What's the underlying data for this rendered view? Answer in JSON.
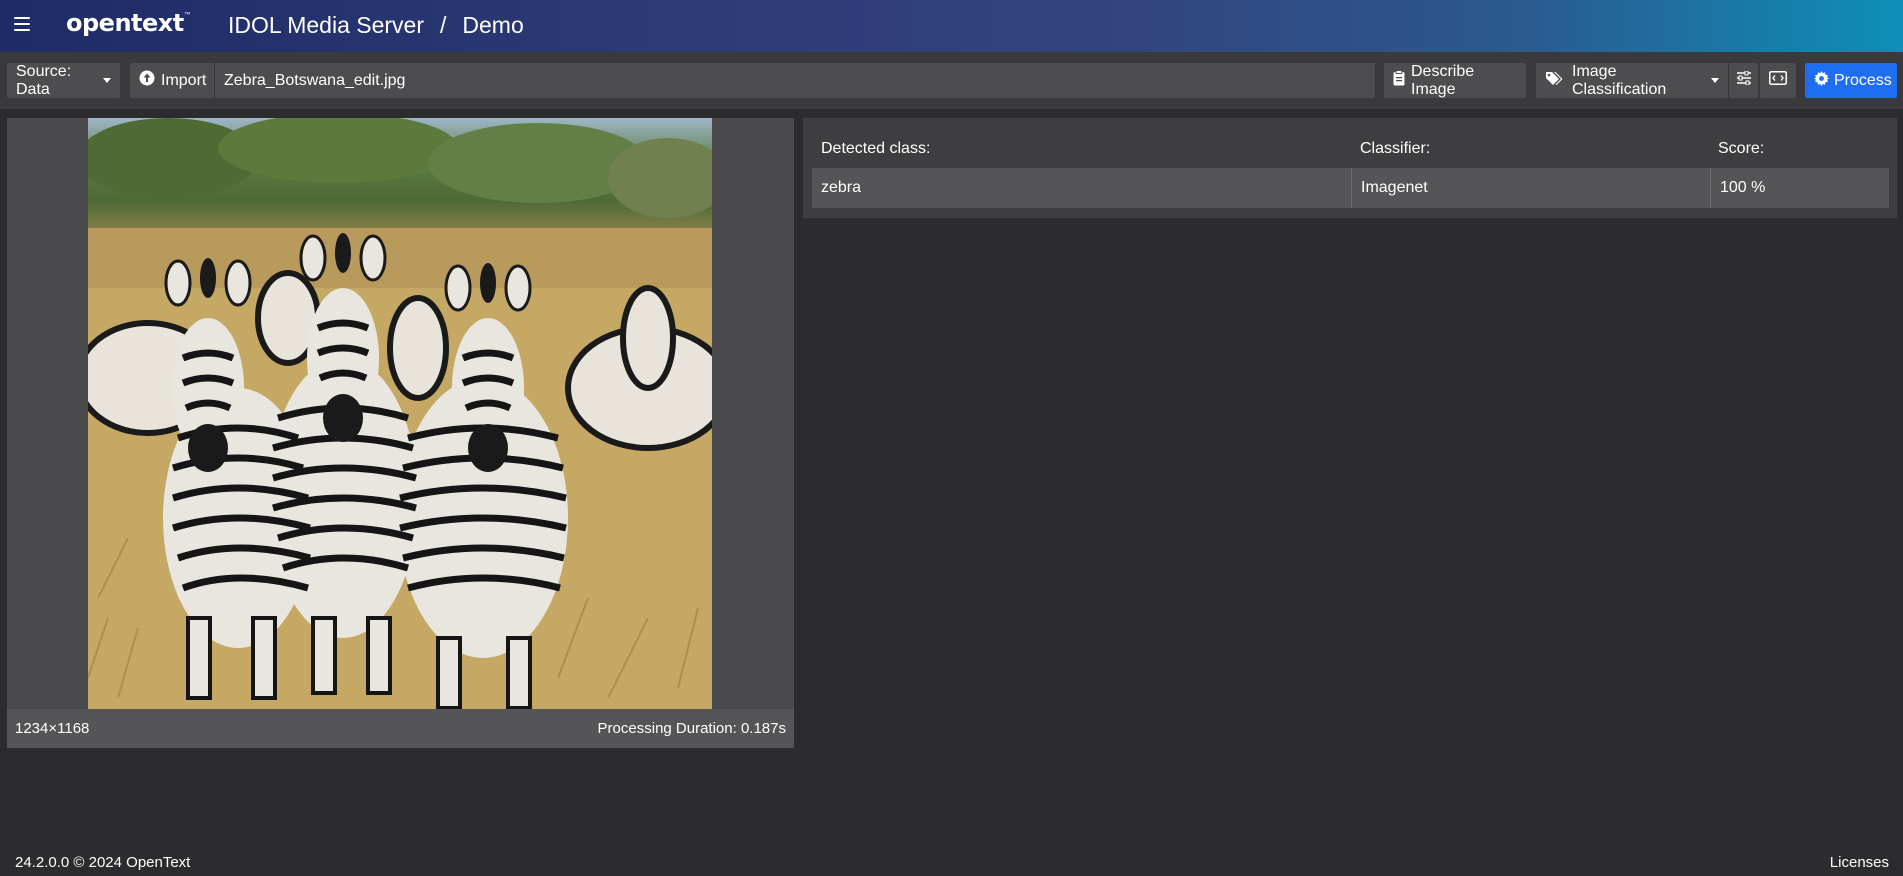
{
  "header": {
    "logo": "opentext",
    "logo_tm": "™",
    "app_name": "IDOL Media Server",
    "separator": "/",
    "page": "Demo"
  },
  "toolbar": {
    "source_label": "Source: Data",
    "import_label": "Import",
    "file_name": "Zebra_Botswana_edit.jpg",
    "describe_label": "Describe Image",
    "classification_label": "Image Classification",
    "process_label": "Process"
  },
  "image": {
    "dimensions": "1234×1168",
    "duration_label": "Processing Duration:",
    "duration_value": "0.187s"
  },
  "results": {
    "headers": [
      "Detected class:",
      "Classifier:",
      "Score:"
    ],
    "rows": [
      {
        "class": "zebra",
        "classifier": "Imagenet",
        "score": "100 %"
      }
    ]
  },
  "footer": {
    "version": "24.2.0.0",
    "copyright": "© 2024 OpenText",
    "licenses": "Licenses"
  },
  "colors": {
    "accent": "#1f6ef2",
    "background": "#2c2c2e",
    "panel": "#4a4a4c"
  },
  "icons": [
    "menu-icon",
    "upload-icon",
    "clipboard-icon",
    "tags-icon",
    "sliders-icon",
    "code-icon",
    "gear-icon"
  ]
}
